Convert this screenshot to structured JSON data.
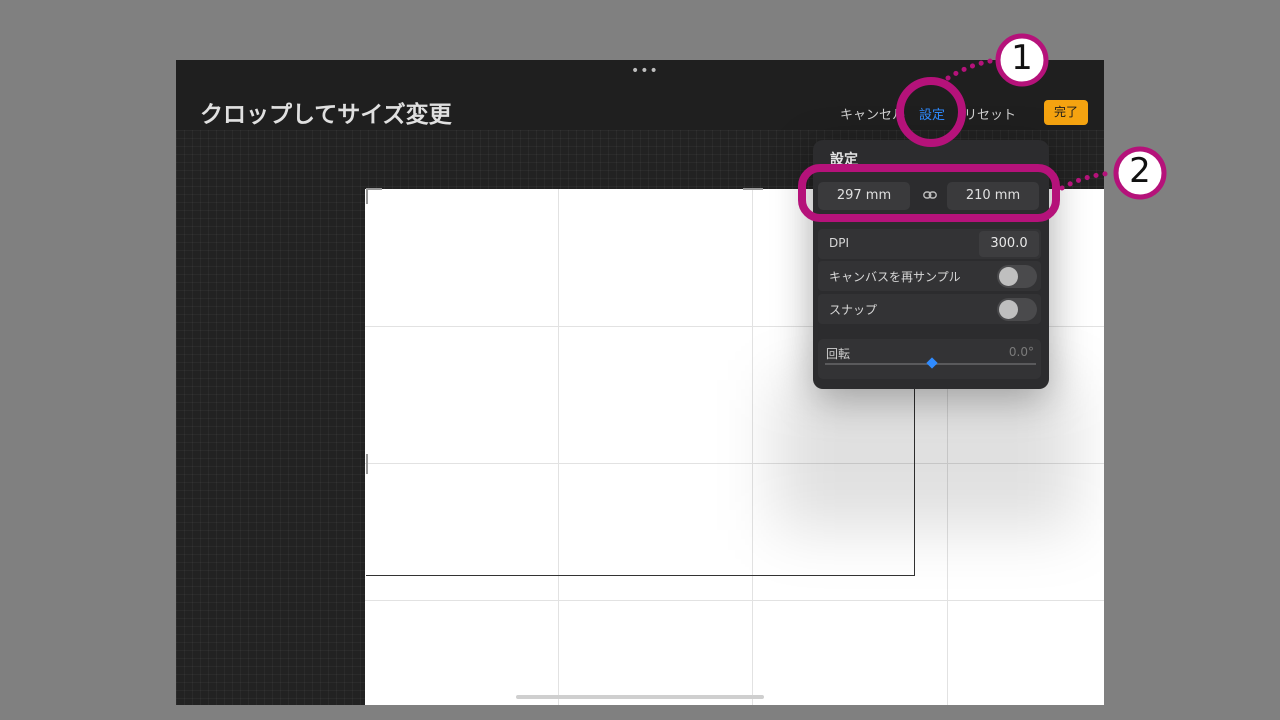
{
  "header": {
    "title": "クロップしてサイズ変更",
    "cancel_label": "キャンセル",
    "settings_label": "設定",
    "reset_label": "リセット",
    "done_label": "完了",
    "handle_dots": "•••"
  },
  "panel": {
    "title": "設定",
    "width_value": "297 mm",
    "height_value": "210 mm",
    "link_icon": "link-icon",
    "dpi_label": "DPI",
    "dpi_value": "300.0",
    "resample_label": "キャンバスを再サンプル",
    "resample_on": false,
    "snap_label": "スナップ",
    "snap_on": false,
    "rotation_label": "回転",
    "rotation_value": "0.0°"
  },
  "annotations": {
    "marker_1": "1",
    "marker_2": "2",
    "color": "#b5127a"
  },
  "colors": {
    "accent_blue": "#2f8bff",
    "done_orange": "#f5a310"
  }
}
